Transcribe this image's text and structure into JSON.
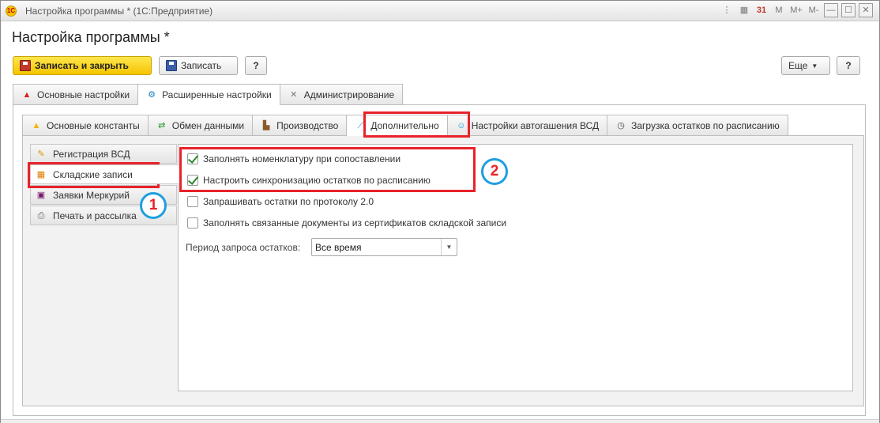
{
  "window": {
    "title": "Настройка программы * (1С:Предприятие)",
    "app_icon": "1С",
    "controls": {
      "more_icon": "⋮",
      "calc_icon": "▦",
      "calendar_icon": "31",
      "m": "M",
      "m_plus": "M+",
      "m_minus": "M-",
      "minimize": "—",
      "maximize": "☐",
      "close": "✕"
    }
  },
  "form": {
    "title": "Настройка программы *"
  },
  "toolbar": {
    "save_close": "Записать и закрыть",
    "save": "Записать",
    "help": "?",
    "more": "Еще",
    "help2": "?"
  },
  "tabs_top": [
    {
      "label": "Основные настройки",
      "icon": "warning-icon"
    },
    {
      "label": "Расширенные настройки",
      "icon": "network-icon"
    },
    {
      "label": "Администрирование",
      "icon": "tools-icon"
    }
  ],
  "tabs_sub": [
    {
      "label": "Основные константы",
      "icon": "warning-icon"
    },
    {
      "label": "Обмен данными",
      "icon": "sync-icon"
    },
    {
      "label": "Производство",
      "icon": "factory-icon"
    },
    {
      "label": "Дополнительно",
      "icon": "syringe-icon"
    },
    {
      "label": "Настройки автогашения ВСД",
      "icon": "robot-icon"
    },
    {
      "label": "Загрузка остатков по расписанию",
      "icon": "clock-icon"
    }
  ],
  "sidebar": [
    {
      "label": "Регистрация ВСД"
    },
    {
      "label": "Складские записи"
    },
    {
      "label": "Заявки Меркурий"
    },
    {
      "label": "Печать и рассылка"
    }
  ],
  "options": [
    {
      "label": "Заполнять номенклатуру при сопоставлении",
      "checked": true
    },
    {
      "label": "Настроить синхронизацию остатков по расписанию",
      "checked": true
    },
    {
      "label": "Запрашивать остатки по протоколу 2.0",
      "checked": false
    },
    {
      "label": "Заполнять связанные документы из сертификатов складской записи",
      "checked": false
    }
  ],
  "period": {
    "label": "Период запроса остатков:",
    "value": "Все время"
  },
  "annotations": {
    "one": "1",
    "two": "2",
    "color": "#e8222a",
    "circle_color": "#1f9fe0"
  }
}
